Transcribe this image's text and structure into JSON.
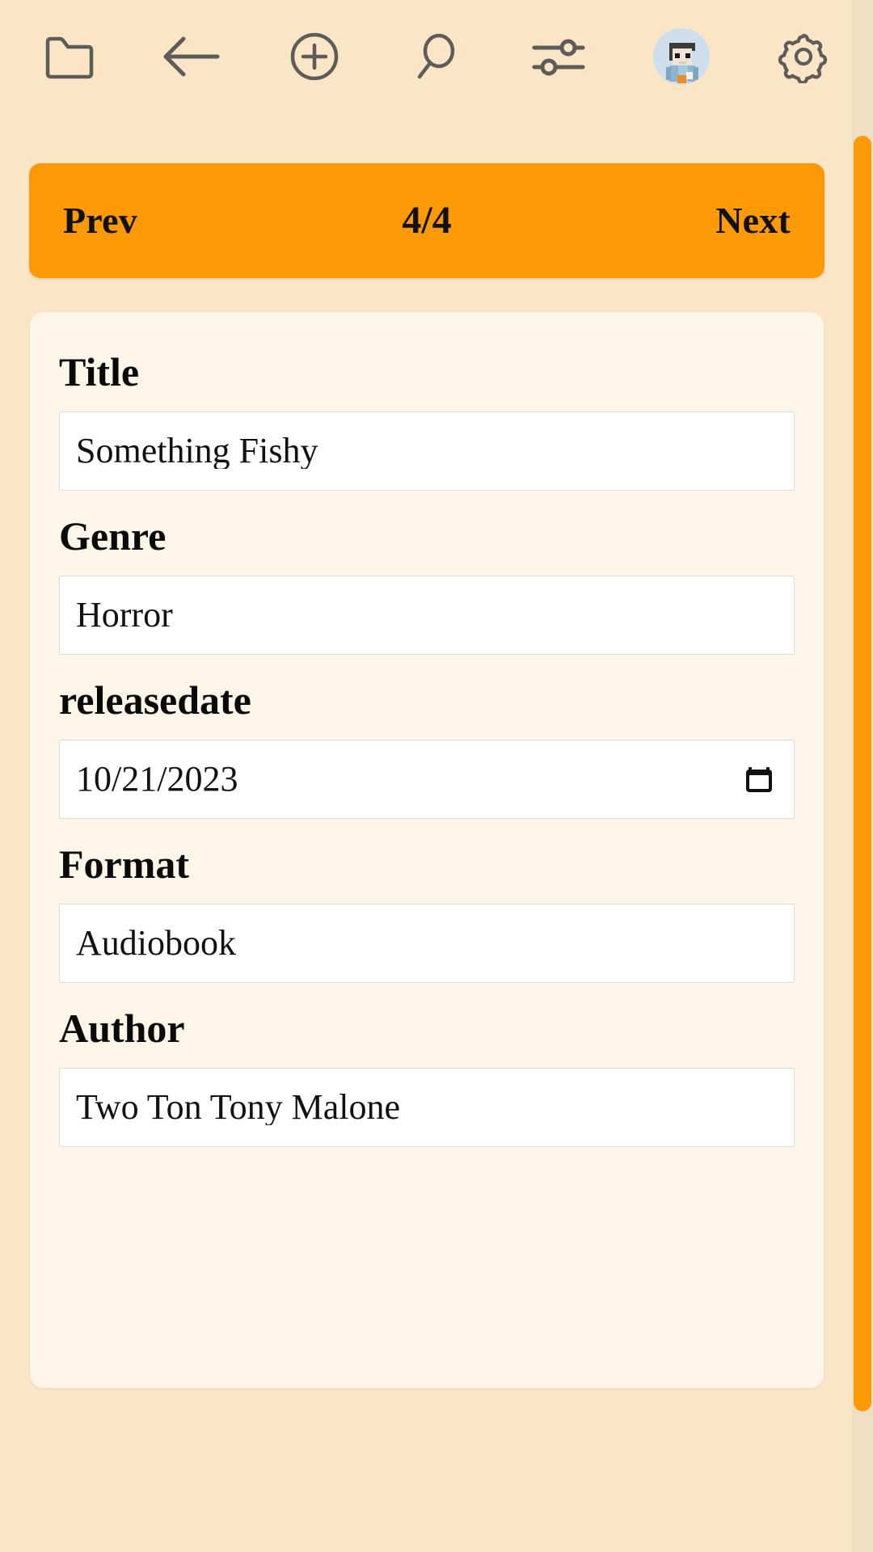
{
  "theme": {
    "page_background": "#fae5c6",
    "accent_orange": "#fb9a06",
    "card_background": "#fdf5e7",
    "input_background": "#ffffff",
    "icon_stroke": "#5d5c58",
    "text_color": "#0a0a0a"
  },
  "toolbar": {
    "icons": [
      {
        "name": "folder-icon",
        "label": "Folder"
      },
      {
        "name": "back-arrow-icon",
        "label": "Back"
      },
      {
        "name": "add-circle-icon",
        "label": "Add"
      },
      {
        "name": "search-icon",
        "label": "Search"
      },
      {
        "name": "filter-sliders-icon",
        "label": "Filters"
      },
      {
        "name": "avatar",
        "label": "Account"
      },
      {
        "name": "gear-icon",
        "label": "Settings"
      }
    ]
  },
  "pager": {
    "prev_label": "Prev",
    "counter": "4/4",
    "next_label": "Next",
    "current_page": 4,
    "total_pages": 4
  },
  "record": {
    "fields": [
      {
        "label": "Title",
        "value": "Something Fishy",
        "type": "text"
      },
      {
        "label": "Genre",
        "value": "Horror",
        "type": "text"
      },
      {
        "label": "releasedate",
        "value": "10/21/2023",
        "type": "date"
      },
      {
        "label": "Format",
        "value": "Audiobook",
        "type": "text"
      },
      {
        "label": "Author",
        "value": "Two Ton Tony Malone",
        "type": "text"
      }
    ]
  },
  "scrollbar": {
    "orientation": "vertical",
    "thumb_color": "#fb9a06"
  }
}
